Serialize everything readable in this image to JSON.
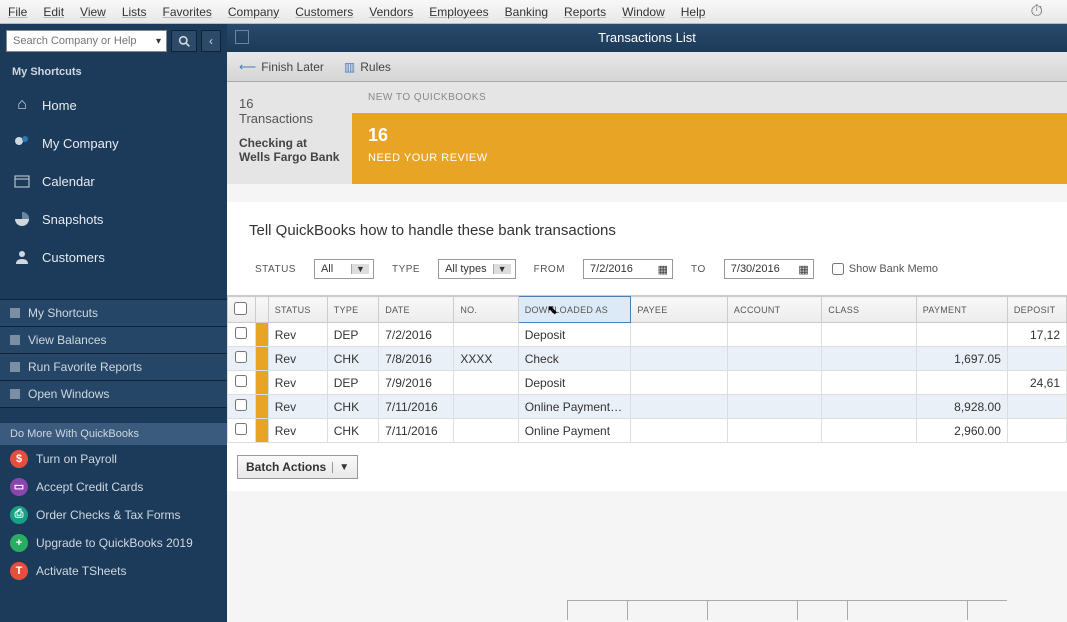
{
  "menubar": [
    "File",
    "Edit",
    "View",
    "Lists",
    "Favorites",
    "Company",
    "Customers",
    "Vendors",
    "Employees",
    "Banking",
    "Reports",
    "Window",
    "Help"
  ],
  "search": {
    "placeholder": "Search Company or Help"
  },
  "sidebar": {
    "title": "My Shortcuts",
    "shortcuts": [
      {
        "label": "Home",
        "icon": "home"
      },
      {
        "label": "My Company",
        "icon": "company"
      },
      {
        "label": "Calendar",
        "icon": "calendar"
      },
      {
        "label": "Snapshots",
        "icon": "pie"
      },
      {
        "label": "Customers",
        "icon": "person"
      }
    ],
    "lists": [
      "My Shortcuts",
      "View Balances",
      "Run Favorite Reports",
      "Open Windows"
    ],
    "domore_title": "Do More With QuickBooks",
    "domore": [
      {
        "label": "Turn on Payroll",
        "color": "#e84c3d"
      },
      {
        "label": "Accept Credit Cards",
        "color": "#8e44ad"
      },
      {
        "label": "Order Checks & Tax Forms",
        "color": "#16a085"
      },
      {
        "label": "Upgrade to QuickBooks 2019",
        "color": "#27ae60"
      },
      {
        "label": "Activate TSheets",
        "color": "#e74c3c"
      }
    ]
  },
  "window": {
    "title": "Transactions List",
    "toolbar": {
      "finish_later": "Finish Later",
      "rules": "Rules"
    }
  },
  "summary": {
    "count": "16",
    "count_label": "Transactions",
    "account": "Checking at Wells Fargo Bank",
    "new_label": "NEW TO QUICKBOOKS",
    "review_count": "16",
    "review_label": "NEED YOUR REVIEW"
  },
  "instruction": "Tell QuickBooks how to handle these bank transactions",
  "filters": {
    "status_label": "STATUS",
    "status_value": "All",
    "type_label": "TYPE",
    "type_value": "All types",
    "from_label": "FROM",
    "from_value": "7/2/2016",
    "to_label": "TO",
    "to_value": "7/30/2016",
    "show_memo": "Show Bank Memo"
  },
  "table": {
    "headers": [
      "",
      "",
      "STATUS",
      "TYPE",
      "DATE",
      "NO.",
      "DOWNLOADED AS",
      "PAYEE",
      "ACCOUNT",
      "CLASS",
      "PAYMENT",
      "DEPOSIT"
    ],
    "rows": [
      {
        "status": "Rev",
        "type": "DEP",
        "date": "7/2/2016",
        "no": "",
        "downloaded": "Deposit",
        "payee": "",
        "account": "",
        "class": "",
        "payment": "",
        "deposit": "17,12"
      },
      {
        "status": "Rev",
        "type": "CHK",
        "date": "7/8/2016",
        "no": "XXXX",
        "downloaded": "Check",
        "payee": "",
        "account": "",
        "class": "",
        "payment": "1,697.05",
        "deposit": ""
      },
      {
        "status": "Rev",
        "type": "DEP",
        "date": "7/9/2016",
        "no": "",
        "downloaded": "Deposit",
        "payee": "",
        "account": "",
        "class": "",
        "payment": "",
        "deposit": "24,61"
      },
      {
        "status": "Rev",
        "type": "CHK",
        "date": "7/11/2016",
        "no": "",
        "downloaded": "Online Payment…",
        "payee": "",
        "account": "",
        "class": "",
        "payment": "8,928.00",
        "deposit": ""
      },
      {
        "status": "Rev",
        "type": "CHK",
        "date": "7/11/2016",
        "no": "",
        "downloaded": "Online Payment",
        "payee": "",
        "account": "",
        "class": "",
        "payment": "2,960.00",
        "deposit": ""
      }
    ]
  },
  "batch_actions": "Batch Actions"
}
